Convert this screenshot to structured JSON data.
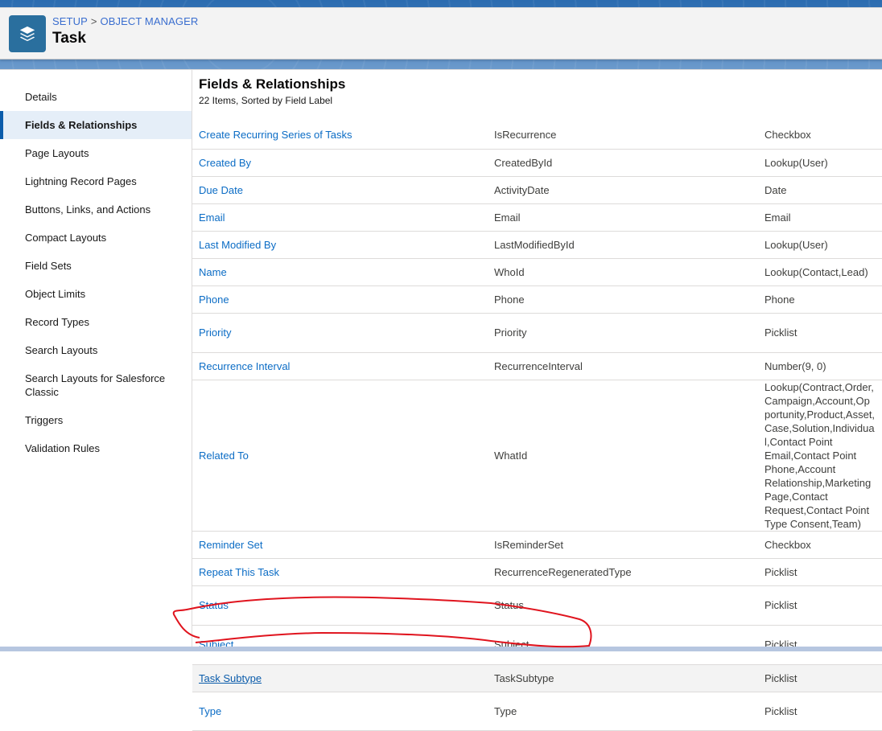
{
  "header": {
    "breadcrumb": [
      "SETUP",
      "OBJECT MANAGER"
    ],
    "breadcrumb_separator": ">",
    "title": "Task",
    "icon": "layers-icon",
    "icon_color": "#2a6f9e"
  },
  "sidebar": {
    "items": [
      {
        "label": "Details"
      },
      {
        "label": "Fields & Relationships",
        "active": true
      },
      {
        "label": "Page Layouts"
      },
      {
        "label": "Lightning Record Pages"
      },
      {
        "label": "Buttons, Links, and Actions"
      },
      {
        "label": "Compact Layouts"
      },
      {
        "label": "Field Sets"
      },
      {
        "label": "Object Limits"
      },
      {
        "label": "Record Types"
      },
      {
        "label": "Search Layouts"
      },
      {
        "label": "Search Layouts for Salesforce Classic"
      },
      {
        "label": "Triggers"
      },
      {
        "label": "Validation Rules"
      }
    ]
  },
  "main": {
    "title": "Fields & Relationships",
    "subtitle": "22 Items, Sorted by Field Label",
    "rows": [
      {
        "label": "Create Recurring Series of Tasks",
        "api": "IsRecurrence",
        "type": "Checkbox",
        "h": 34
      },
      {
        "label": "Created By",
        "api": "CreatedById",
        "type": "Lookup(User)",
        "h": 34
      },
      {
        "label": "Due Date",
        "api": "ActivityDate",
        "type": "Date",
        "h": 34
      },
      {
        "label": "Email",
        "api": "Email",
        "type": "Email",
        "h": 34
      },
      {
        "label": "Last Modified By",
        "api": "LastModifiedById",
        "type": "Lookup(User)",
        "h": 34
      },
      {
        "label": "Name",
        "api": "WhoId",
        "type": "Lookup(Contact,Lead)",
        "h": 34
      },
      {
        "label": "Phone",
        "api": "Phone",
        "type": "Phone",
        "h": 34
      },
      {
        "label": "Priority",
        "api": "Priority",
        "type": "Picklist",
        "h": 49
      },
      {
        "label": "Recurrence Interval",
        "api": "RecurrenceInterval",
        "type": "Number(9, 0)",
        "h": 34
      },
      {
        "label": "Related To",
        "api": "WhatId",
        "type": "Lookup(Contract,Order,Campaign,Account,Opportunity,Product,Asset,Case,Solution,Individual,Contact Point Email,Contact Point Phone,Account Relationship,Marketing Page,Contact Request,Contact Point Type Consent,Team)",
        "type_visible": "Lookup(Contract,Order,C… Relationship,Marketing P… Page,Contact Request,Co… Consent,Team)",
        "h": 85
      },
      {
        "label": "Reminder Set",
        "api": "IsReminderSet",
        "type": "Checkbox",
        "h": 34
      },
      {
        "label": "Repeat This Task",
        "api": "RecurrenceRegeneratedType",
        "type": "Picklist",
        "h": 34
      },
      {
        "label": "Status",
        "api": "Status",
        "type": "Picklist",
        "h": 49
      },
      {
        "label": "Subject",
        "api": "Subject",
        "type": "Picklist",
        "h": 49
      },
      {
        "label": "Task Subtype",
        "api": "TaskSubtype",
        "type": "Picklist",
        "h": 34,
        "hover": true
      },
      {
        "label": "Type",
        "api": "Type",
        "type": "Picklist",
        "h": 48,
        "annotated": true
      }
    ]
  },
  "colors": {
    "link": "#0b6cc5",
    "active_nav_bg": "#e5eef8",
    "active_nav_bar": "#0b5cab",
    "annotation": "#e0141e"
  }
}
